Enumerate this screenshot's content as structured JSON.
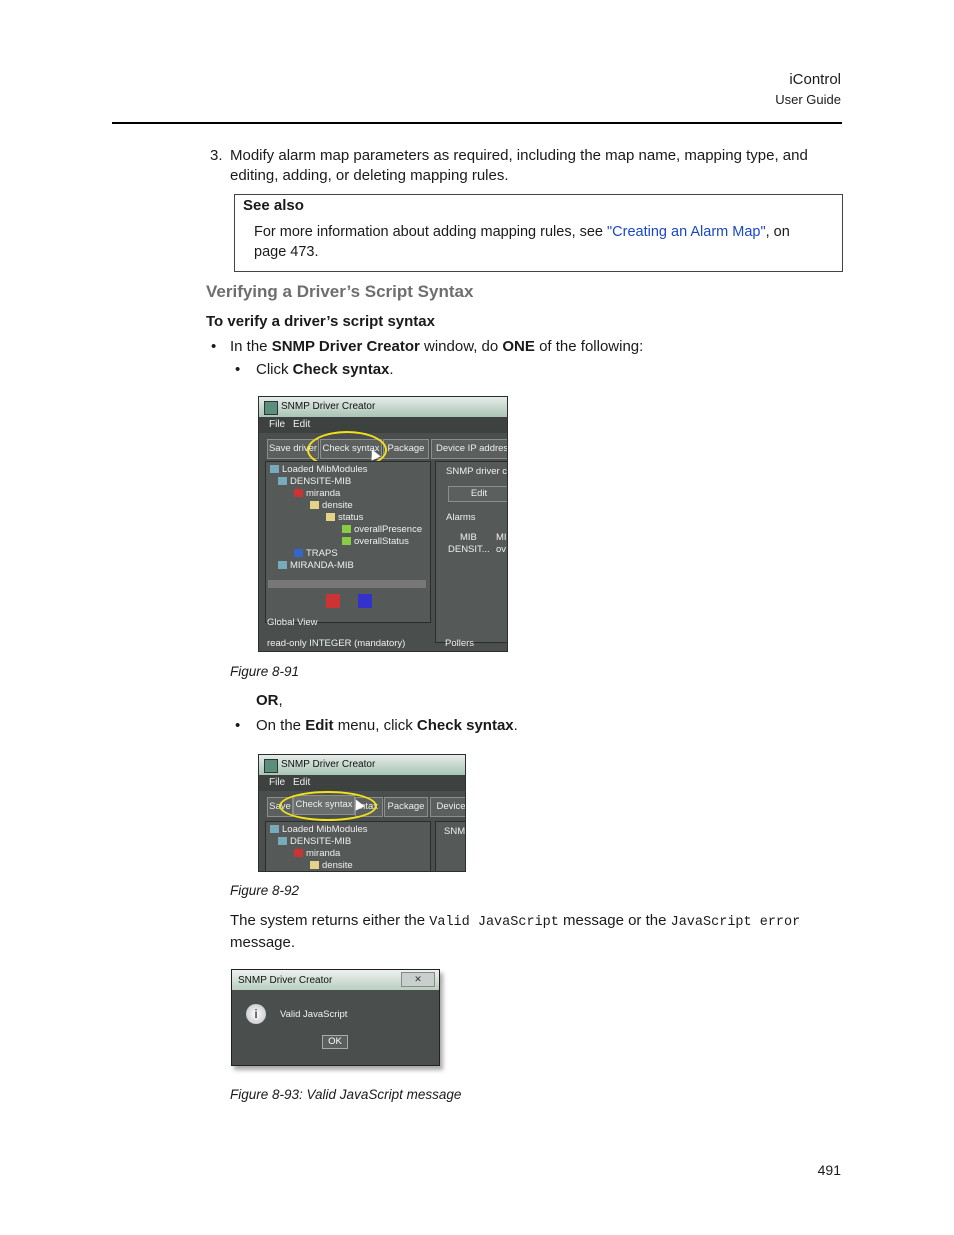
{
  "header": {
    "product": "iControl",
    "doc": "User Guide"
  },
  "step3": {
    "number": "3.",
    "text": "Modify alarm map parameters as required, including the map name, mapping type, and editing, adding, or deleting mapping rules."
  },
  "see_also": {
    "title": "See also",
    "text_before": "For more information about adding mapping rules, see ",
    "link": "\"Creating an Alarm Map\"",
    "text_after": ", on page 473."
  },
  "section": {
    "heading": "Verifying a Driver’s Script Syntax",
    "procedure": "To verify a driver’s script syntax"
  },
  "bullets": {
    "b1_a": "In the ",
    "b1_bold1": "SNMP Driver Creator",
    "b1_b": " window, do ",
    "b1_bold2": "ONE",
    "b1_c": " of the following:",
    "b2_a": "Click ",
    "b2_bold": "Check syntax",
    "b2_b": ".",
    "or": "OR",
    "or_comma": ",",
    "b3_a": "On the ",
    "b3_bold1": "Edit",
    "b3_b": " menu, click ",
    "b3_bold2": "Check syntax",
    "b3_c": "."
  },
  "figure1": {
    "title": "SNMP Driver Creator",
    "menu": [
      "File",
      "Edit"
    ],
    "toolbar": [
      "Save driver",
      "Check syntax",
      "Package",
      "Device IP address"
    ],
    "tree": [
      "Loaded MibModules",
      "DENSITE-MIB",
      "miranda",
      "densite",
      "status",
      "overallPresence",
      "overallStatus",
      "TRAPS",
      "MIRANDA-MIB"
    ],
    "right_tab": "SNMP driver co",
    "edit_btn": "Edit",
    "alarms_label": "Alarms",
    "col_mib": "MIB",
    "col_mi": "MI",
    "row_mib": "DENSIT...",
    "row_ov": "ov",
    "global_view": "Global View",
    "status_text": "read-only INTEGER (mandatory)",
    "pollers": "Pollers",
    "caption": "Figure 8-91"
  },
  "figure2": {
    "title": "SNMP Driver Creator",
    "menu": [
      "File",
      "Edit"
    ],
    "toolbar": [
      "Save",
      "Check syntax",
      "ntax",
      "Package",
      "Device"
    ],
    "tree": [
      "Loaded MibModules",
      "DENSITE-MIB",
      "miranda",
      "densite"
    ],
    "right_tab": "SNM",
    "caption": "Figure 8-92"
  },
  "returns": {
    "a": "The system returns either the ",
    "code1": "Valid JavaScript",
    "b": " message or the ",
    "code2": "JavaScript error",
    "c": " message."
  },
  "figure3": {
    "title": "SNMP Driver Creator",
    "close": "✕",
    "message": "Valid JavaScript",
    "ok": "OK",
    "caption": "Figure 8-93:  Valid JavaScript message"
  },
  "page_number": "491"
}
